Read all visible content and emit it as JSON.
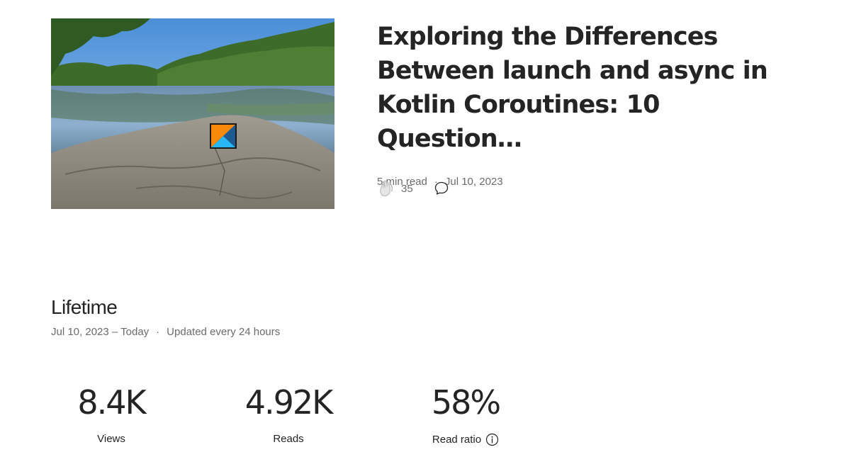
{
  "story": {
    "title": "Exploring the Differences Between launch and async in Kotlin Coroutines: 10 Question…",
    "read_time": "5 min read",
    "separator": "·",
    "date": "Jul 10, 2023",
    "claps": "35",
    "thumbnail_icon": "kotlin-logo"
  },
  "lifetime": {
    "title": "Lifetime",
    "range": "Jul 10, 2023 – Today",
    "separator": "·",
    "updated": "Updated every 24 hours"
  },
  "stats": [
    {
      "value": "8.4K",
      "label": "Views"
    },
    {
      "value": "4.92K",
      "label": "Reads"
    },
    {
      "value": "58%",
      "label": "Read ratio"
    }
  ],
  "colors": {
    "text_primary": "#242424",
    "text_secondary": "#6b6b6b"
  }
}
